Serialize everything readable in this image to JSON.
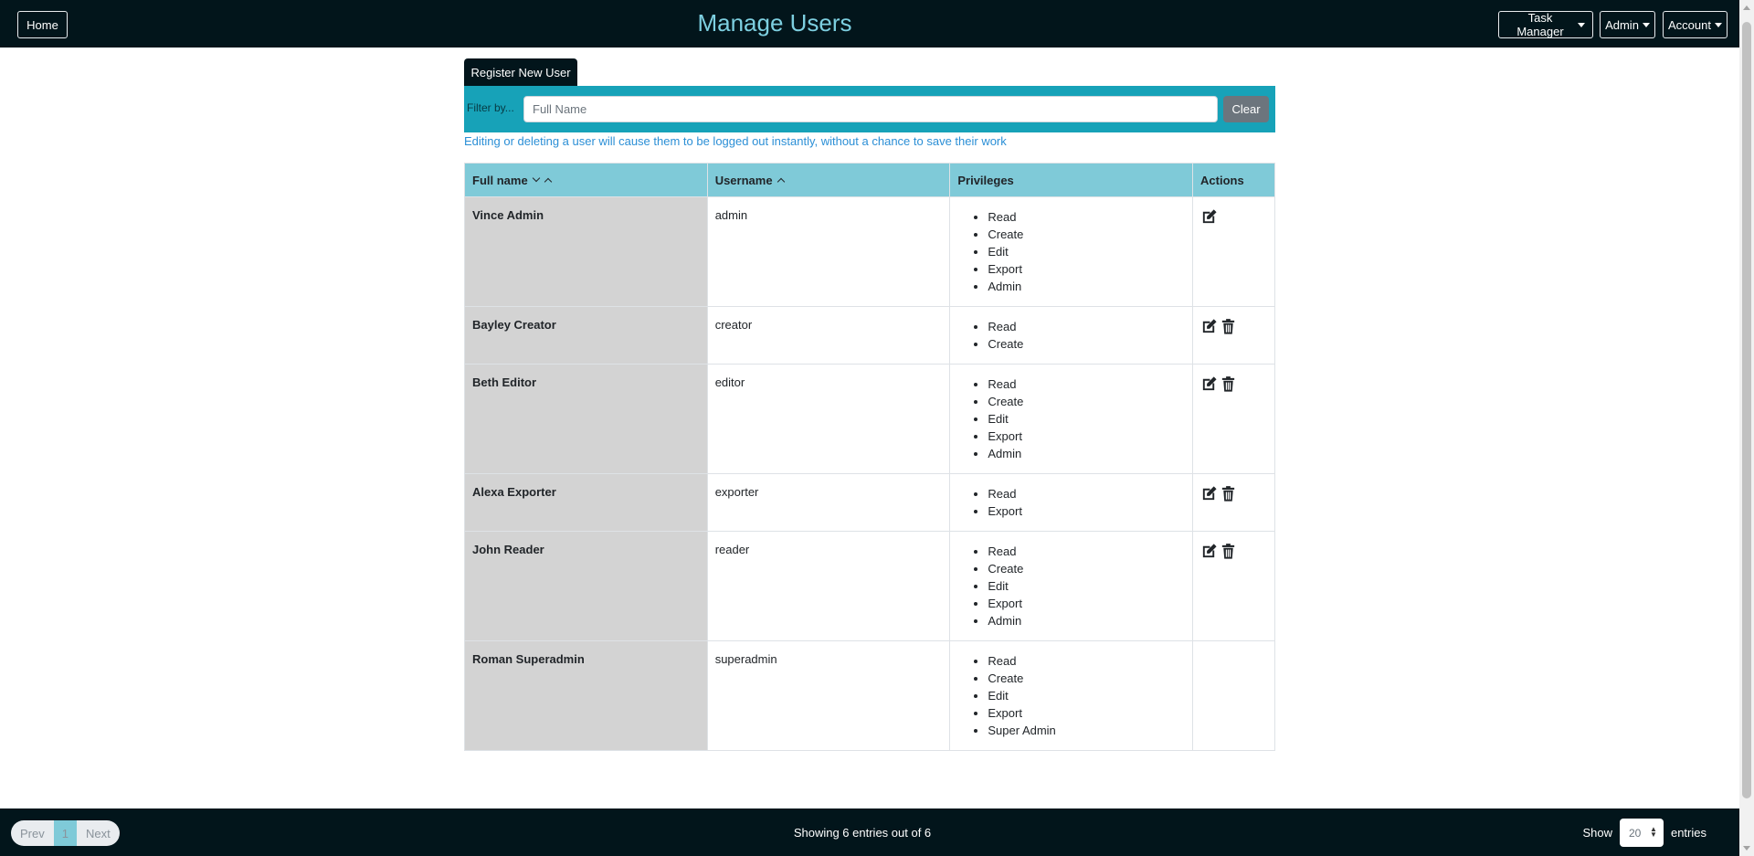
{
  "header": {
    "home_label": "Home",
    "title": "Manage Users",
    "menus": [
      {
        "label": "Task Manager"
      },
      {
        "label": "Admin"
      },
      {
        "label": "Account"
      }
    ]
  },
  "toolbar": {
    "register_label": "Register New User",
    "filter_label": "Filter by...",
    "filter_placeholder": "Full Name",
    "filter_value": "",
    "clear_label": "Clear",
    "warning_text": "Editing or deleting a user will cause them to be logged out instantly, without a chance to save their work"
  },
  "table": {
    "columns": [
      "Full name",
      "Username",
      "Privileges",
      "Actions"
    ],
    "rows": [
      {
        "full_name": "Vince Admin",
        "username": "admin",
        "privileges": [
          "Read",
          "Create",
          "Edit",
          "Export",
          "Admin"
        ],
        "actions": [
          "edit"
        ]
      },
      {
        "full_name": "Bayley Creator",
        "username": "creator",
        "privileges": [
          "Read",
          "Create"
        ],
        "actions": [
          "edit",
          "delete"
        ]
      },
      {
        "full_name": "Beth Editor",
        "username": "editor",
        "privileges": [
          "Read",
          "Create",
          "Edit",
          "Export",
          "Admin"
        ],
        "actions": [
          "edit",
          "delete"
        ]
      },
      {
        "full_name": "Alexa Exporter",
        "username": "exporter",
        "privileges": [
          "Read",
          "Export"
        ],
        "actions": [
          "edit",
          "delete"
        ]
      },
      {
        "full_name": "John Reader",
        "username": "reader",
        "privileges": [
          "Read",
          "Create",
          "Edit",
          "Export",
          "Admin"
        ],
        "actions": [
          "edit",
          "delete"
        ]
      },
      {
        "full_name": "Roman Superadmin",
        "username": "superadmin",
        "privileges": [
          "Read",
          "Create",
          "Edit",
          "Export",
          "Super Admin"
        ],
        "actions": []
      }
    ]
  },
  "footer": {
    "prev_label": "Prev",
    "current_page": "1",
    "next_label": "Next",
    "showing_text": "Showing 6 entries out of 6",
    "show_label": "Show",
    "entries_value": "20",
    "entries_label": "entries"
  },
  "icons": {
    "edit": "edit-icon",
    "delete": "trash-icon"
  },
  "colors": {
    "navbar": "#02151b",
    "title": "#7dcfe0",
    "filter_bar": "#17a2b8",
    "table_header": "#7fcad8",
    "name_cell": "#d3d3d3",
    "warning": "#2b8fd6"
  }
}
